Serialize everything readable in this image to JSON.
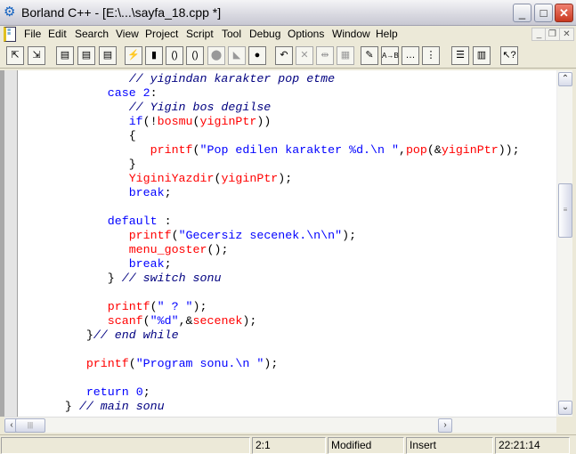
{
  "window": {
    "title": "Borland C++ - [E:\\...\\sayfa_18.cpp *]",
    "minimize": "_",
    "maximize": "□",
    "close": "✕"
  },
  "menu": {
    "items": [
      "File",
      "Edit",
      "Search",
      "View",
      "Project",
      "Script",
      "Tool",
      "Debug",
      "Options",
      "Window",
      "Help"
    ],
    "mdi_minimize": "_",
    "mdi_restore": "❐",
    "mdi_close": "✕"
  },
  "toolbar": {
    "buttons": [
      {
        "icon": "open-project-icon",
        "glyph": "⇱"
      },
      {
        "icon": "save-project-icon",
        "glyph": "⇲"
      },
      {
        "icon": "compile-icon",
        "glyph": "▤"
      },
      {
        "icon": "make-icon",
        "glyph": "▤"
      },
      {
        "icon": "build-icon",
        "glyph": "▤"
      },
      {
        "icon": "run-icon",
        "glyph": "⚡"
      },
      {
        "icon": "step-icon",
        "glyph": "▮"
      },
      {
        "icon": "step-over-icon",
        "glyph": "()"
      },
      {
        "icon": "trace-into-icon",
        "glyph": "()"
      },
      {
        "icon": "stop-icon",
        "glyph": "⬤",
        "disabled": true
      },
      {
        "icon": "pause-icon",
        "glyph": "◣",
        "disabled": true
      },
      {
        "icon": "breakpoint-icon",
        "glyph": "●"
      },
      {
        "icon": "undo-icon",
        "glyph": "↶"
      },
      {
        "icon": "cut-icon",
        "glyph": "✕",
        "disabled": true
      },
      {
        "icon": "copy-icon",
        "glyph": "⇹",
        "disabled": true
      },
      {
        "icon": "paste-icon",
        "glyph": "▦",
        "disabled": true
      },
      {
        "icon": "find-icon",
        "glyph": "✎"
      },
      {
        "icon": "replace-icon",
        "glyph": "A→B"
      },
      {
        "icon": "search-again-icon",
        "glyph": "…"
      },
      {
        "icon": "browse-icon",
        "glyph": "⋮"
      },
      {
        "icon": "message-window-icon",
        "glyph": "☰"
      },
      {
        "icon": "project-window-icon",
        "glyph": "▥"
      },
      {
        "icon": "context-help-icon",
        "glyph": "↖?"
      }
    ]
  },
  "editor": {
    "lines": [
      {
        "indent": 12,
        "tokens": [
          [
            "// yigindan karakter pop etme",
            "c"
          ]
        ]
      },
      {
        "indent": 9,
        "tokens": [
          [
            "case",
            "k"
          ],
          [
            " ",
            "p"
          ],
          [
            "2",
            "k"
          ],
          [
            ":",
            "p"
          ]
        ]
      },
      {
        "indent": 12,
        "tokens": [
          [
            "// Yigin bos degilse",
            "c"
          ]
        ]
      },
      {
        "indent": 12,
        "tokens": [
          [
            "if",
            "k"
          ],
          [
            "(!",
            "p"
          ],
          [
            "bosmu",
            "f"
          ],
          [
            "(",
            "p"
          ],
          [
            "yiginPtr",
            "f"
          ],
          [
            "))",
            "p"
          ]
        ]
      },
      {
        "indent": 12,
        "tokens": [
          [
            "{",
            "p"
          ]
        ]
      },
      {
        "indent": 15,
        "tokens": [
          [
            "printf",
            "f"
          ],
          [
            "(",
            "p"
          ],
          [
            "\"Pop edilen karakter %d.\\n \"",
            "s"
          ],
          [
            ",",
            "p"
          ],
          [
            "pop",
            "f"
          ],
          [
            "(&",
            "p"
          ],
          [
            "yiginPtr",
            "f"
          ],
          [
            "));",
            "p"
          ]
        ]
      },
      {
        "indent": 12,
        "tokens": [
          [
            "}",
            "p"
          ]
        ]
      },
      {
        "indent": 12,
        "tokens": [
          [
            "YiginiYazdir",
            "f"
          ],
          [
            "(",
            "p"
          ],
          [
            "yiginPtr",
            "f"
          ],
          [
            ");",
            "p"
          ]
        ]
      },
      {
        "indent": 12,
        "tokens": [
          [
            "break",
            "k"
          ],
          [
            ";",
            "p"
          ]
        ]
      },
      {
        "indent": 0,
        "tokens": []
      },
      {
        "indent": 9,
        "tokens": [
          [
            "default",
            "k"
          ],
          [
            " :",
            "p"
          ]
        ]
      },
      {
        "indent": 12,
        "tokens": [
          [
            "printf",
            "f"
          ],
          [
            "(",
            "p"
          ],
          [
            "\"Gecersiz secenek.\\n\\n\"",
            "s"
          ],
          [
            ");",
            "p"
          ]
        ]
      },
      {
        "indent": 12,
        "tokens": [
          [
            "menu_goster",
            "f"
          ],
          [
            "();",
            "p"
          ]
        ]
      },
      {
        "indent": 12,
        "tokens": [
          [
            "break",
            "k"
          ],
          [
            ";",
            "p"
          ]
        ]
      },
      {
        "indent": 9,
        "tokens": [
          [
            "}",
            "p"
          ],
          [
            " // switch sonu",
            "c"
          ]
        ]
      },
      {
        "indent": 0,
        "tokens": []
      },
      {
        "indent": 9,
        "tokens": [
          [
            "printf",
            "f"
          ],
          [
            "(",
            "p"
          ],
          [
            "\" ? \"",
            "s"
          ],
          [
            ");",
            "p"
          ]
        ]
      },
      {
        "indent": 9,
        "tokens": [
          [
            "scanf",
            "f"
          ],
          [
            "(",
            "p"
          ],
          [
            "\"%d\"",
            "s"
          ],
          [
            ",&",
            "p"
          ],
          [
            "secenek",
            "f"
          ],
          [
            ");",
            "p"
          ]
        ]
      },
      {
        "indent": 6,
        "tokens": [
          [
            "}",
            "p"
          ],
          [
            "// end while",
            "c"
          ]
        ]
      },
      {
        "indent": 0,
        "tokens": []
      },
      {
        "indent": 6,
        "tokens": [
          [
            "printf",
            "f"
          ],
          [
            "(",
            "p"
          ],
          [
            "\"Program sonu.\\n \"",
            "s"
          ],
          [
            ");",
            "p"
          ]
        ]
      },
      {
        "indent": 0,
        "tokens": []
      },
      {
        "indent": 6,
        "tokens": [
          [
            "return",
            "k"
          ],
          [
            " ",
            "p"
          ],
          [
            "0",
            "k"
          ],
          [
            ";",
            "p"
          ]
        ]
      },
      {
        "indent": 3,
        "tokens": [
          [
            "}",
            "p"
          ],
          [
            " // main sonu",
            "c"
          ]
        ]
      }
    ]
  },
  "scroll": {
    "up": "⌃",
    "down": "⌄",
    "left": "‹",
    "right": "›",
    "grip": "|||"
  },
  "status": {
    "message": "",
    "position": "2:1",
    "modified": "Modified",
    "mode": "Insert",
    "time": "22:21:14"
  }
}
